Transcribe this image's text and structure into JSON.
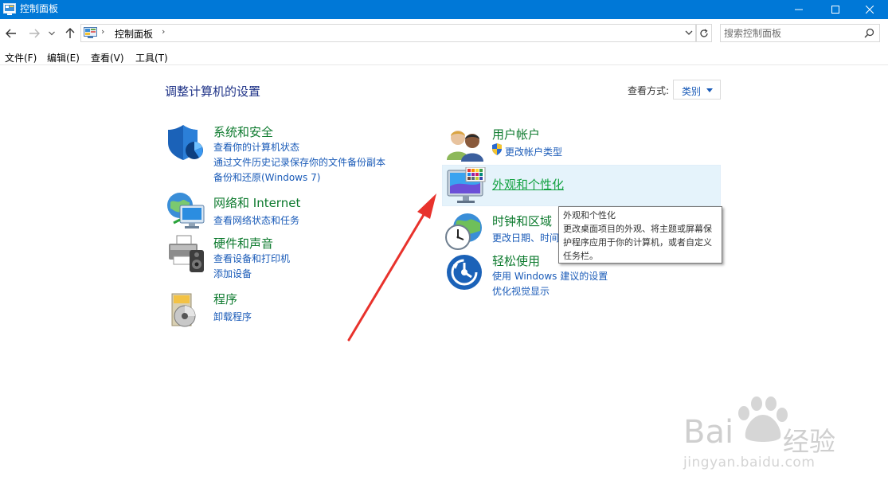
{
  "window": {
    "title": "控制面板"
  },
  "address": {
    "crumb": "控制面板",
    "separator": "›",
    "search_placeholder": "搜索控制面板"
  },
  "menu": {
    "items": [
      "文件(F)",
      "编辑(E)",
      "查看(V)",
      "工具(T)"
    ]
  },
  "content": {
    "page_title": "调整计算机的设置",
    "view_by_label": "查看方式:",
    "view_by_value": "类别"
  },
  "categories": {
    "system": {
      "title": "系统和安全",
      "links": [
        "查看你的计算机状态",
        "通过文件历史记录保存你的文件备份副本",
        "备份和还原(Windows 7)"
      ]
    },
    "network": {
      "title": "网络和 Internet",
      "links": [
        "查看网络状态和任务"
      ]
    },
    "hardware": {
      "title": "硬件和声音",
      "links": [
        "查看设备和打印机",
        "添加设备"
      ]
    },
    "programs": {
      "title": "程序",
      "links": [
        "卸载程序"
      ]
    },
    "users": {
      "title": "用户帐户",
      "links": [
        "更改帐户类型"
      ]
    },
    "appearance": {
      "title": "外观和个性化"
    },
    "clock": {
      "title": "时钟和区域",
      "links": [
        "更改日期、时间"
      ]
    },
    "ease": {
      "title": "轻松使用",
      "links": [
        "使用 Windows 建议的设置",
        "优化视觉显示"
      ]
    }
  },
  "tooltip": {
    "title": "外观和个性化",
    "body": "更改桌面项目的外观、将主题或屏幕保护程序应用于你的计算机，或者自定义任务栏。"
  },
  "watermark": {
    "brand": "Bai",
    "brand2": "经验",
    "url": "jingyan.baidu.com"
  },
  "colors": {
    "titlebar": "#0078d7",
    "category_title": "#0d7a2e",
    "link": "#1a5bb8",
    "page_title": "#1e3287",
    "annotation_arrow": "#e8322c"
  }
}
